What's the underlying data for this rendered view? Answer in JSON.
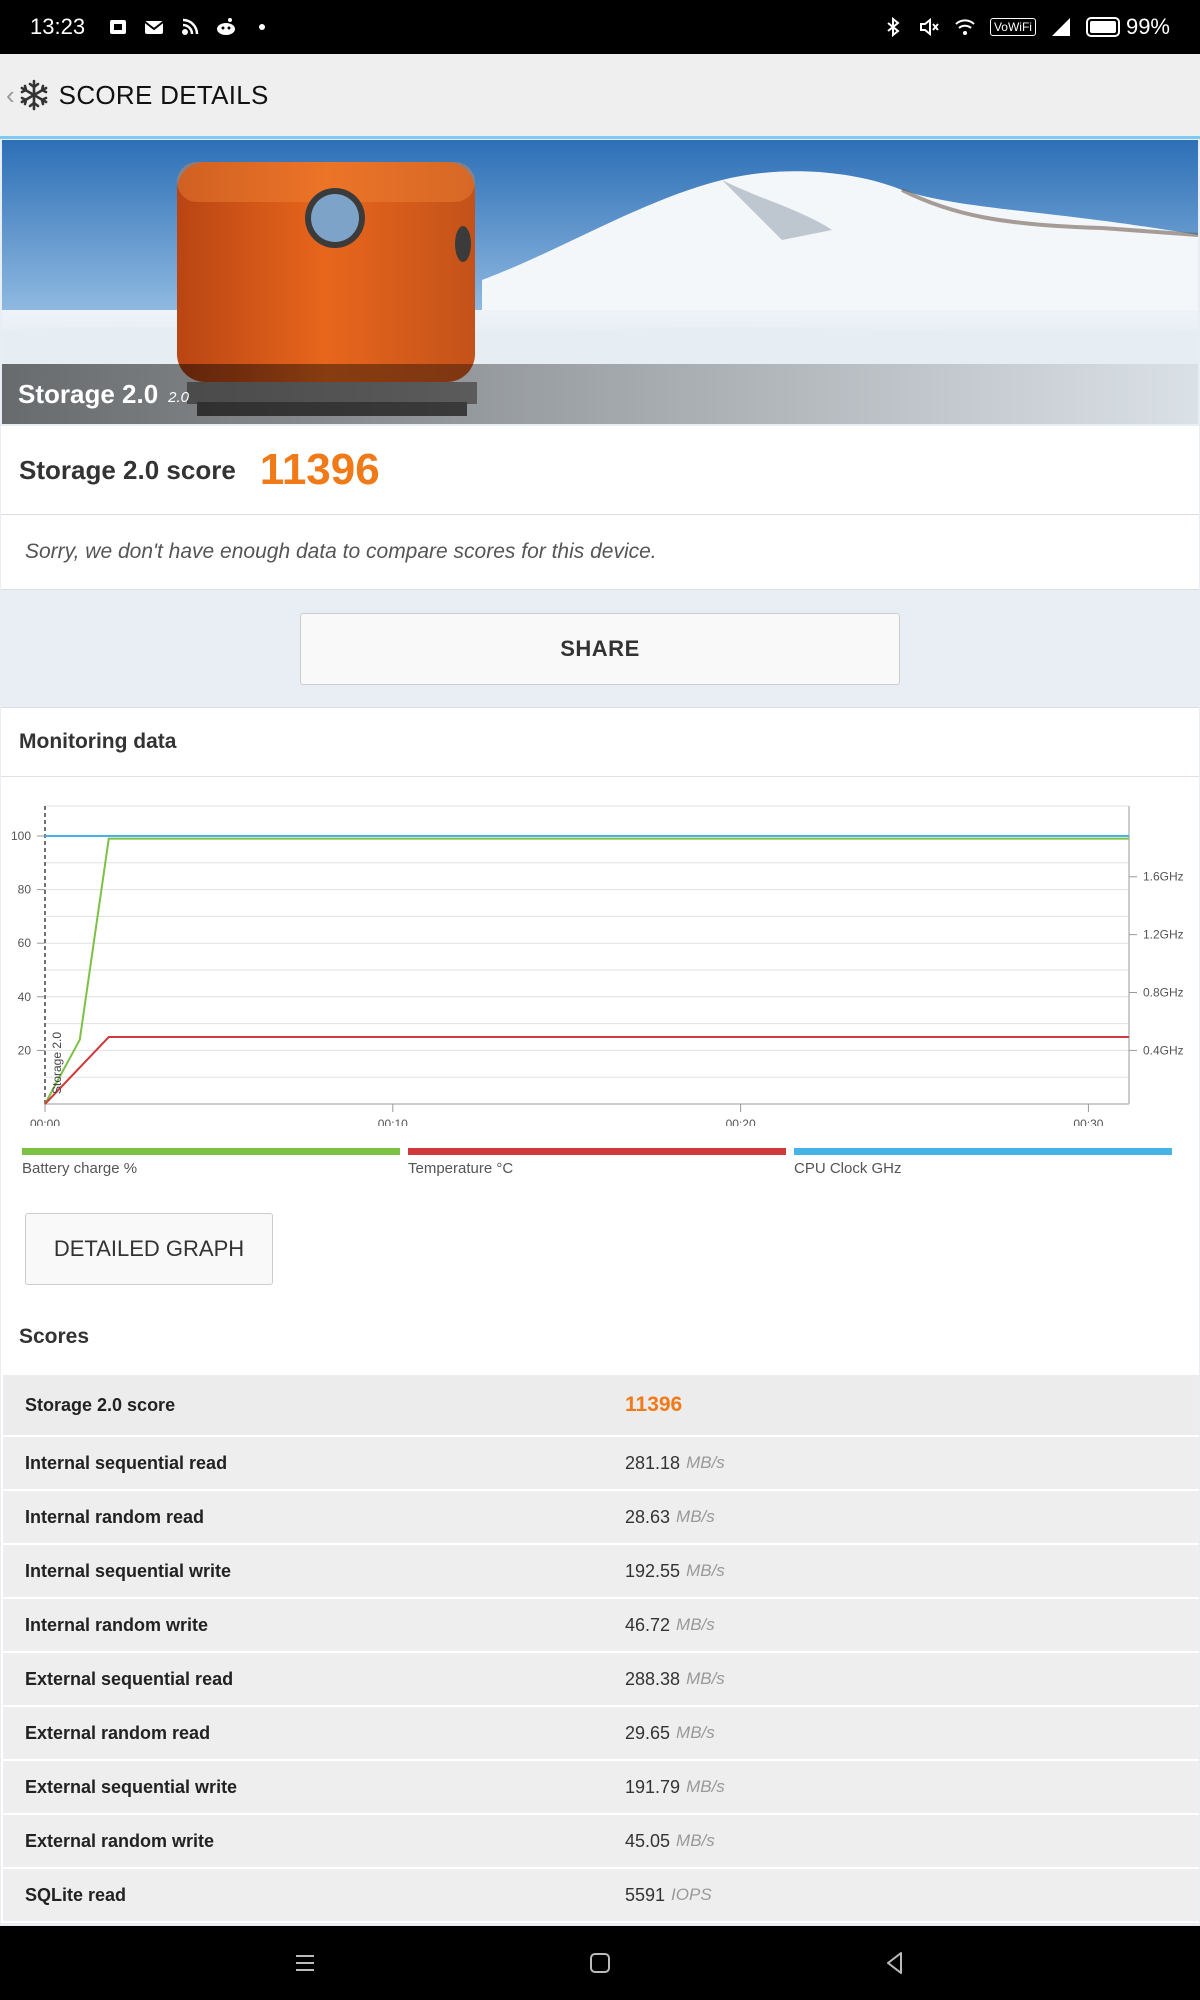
{
  "status_bar": {
    "time": "13:23",
    "battery_percent": "99%",
    "battery_level": 0.99,
    "vowifi": "VoWiFi",
    "icons": [
      "notification-icon",
      "mail-icon",
      "podcast-icon",
      "reddit-icon",
      "dot-icon",
      "bluetooth-icon",
      "mute-icon",
      "wifi-icon",
      "vowifi-badge",
      "signal-icon",
      "battery-icon"
    ]
  },
  "app_bar": {
    "title": "SCORE DETAILS",
    "back_icon": "chevron-left-icon",
    "app_icon": "snowflake-icon"
  },
  "hero": {
    "title": "Storage 2.0",
    "version": "2.0"
  },
  "score": {
    "label": "Storage 2.0 score",
    "value": "11396"
  },
  "notice": "Sorry, we don't have enough data to compare scores for this device.",
  "share_button": "SHARE",
  "monitoring": {
    "title": "Monitoring data",
    "detailed_button": "DETAILED GRAPH",
    "legend": [
      {
        "label": "Battery charge %",
        "color": "#7bc143"
      },
      {
        "label": "Temperature °C",
        "color": "#d13a3a"
      },
      {
        "label": "CPU Clock GHz",
        "color": "#46b3e6"
      }
    ]
  },
  "chart_data": {
    "type": "line",
    "x_ticks": [
      "00:00",
      "00:10",
      "00:20",
      "00:30"
    ],
    "y_ticks": [
      "20",
      "40",
      "60",
      "80",
      "100"
    ],
    "y2_ticks": [
      "0.4GHz",
      "0.8GHz",
      "1.2GHz",
      "1.6GHz"
    ],
    "ylim": [
      0,
      100
    ],
    "xlim_seconds": [
      0,
      1870
    ],
    "annotation": "Storage 2.0",
    "grid": true,
    "series": [
      {
        "name": "Battery charge %",
        "color": "#7bc143",
        "points": [
          [
            0,
            0
          ],
          [
            60,
            24
          ],
          [
            110,
            99
          ],
          [
            1870,
            99
          ]
        ]
      },
      {
        "name": "Temperature °C",
        "color": "#d13a3a",
        "points": [
          [
            0,
            0
          ],
          [
            110,
            25
          ],
          [
            1870,
            25
          ]
        ]
      },
      {
        "name": "CPU Clock GHz",
        "color": "#46b3e6",
        "points": [
          [
            0,
            100
          ],
          [
            1870,
            100
          ]
        ]
      }
    ]
  },
  "scores": {
    "title": "Scores",
    "rows": [
      {
        "label": "Storage 2.0 score",
        "value": "11396",
        "unit": ""
      },
      {
        "label": "Internal sequential read",
        "value": "281.18",
        "unit": "MB/s"
      },
      {
        "label": "Internal random read",
        "value": "28.63",
        "unit": "MB/s"
      },
      {
        "label": "Internal sequential write",
        "value": "192.55",
        "unit": "MB/s"
      },
      {
        "label": "Internal random write",
        "value": "46.72",
        "unit": "MB/s"
      },
      {
        "label": "External sequential read",
        "value": "288.38",
        "unit": "MB/s"
      },
      {
        "label": "External random read",
        "value": "29.65",
        "unit": "MB/s"
      },
      {
        "label": "External sequential write",
        "value": "191.79",
        "unit": "MB/s"
      },
      {
        "label": "External random write",
        "value": "45.05",
        "unit": "MB/s"
      },
      {
        "label": "SQLite read",
        "value": "5591",
        "unit": "IOPS"
      }
    ]
  },
  "nav_bar": {
    "icons": [
      "menu-icon",
      "home-icon",
      "back-icon"
    ]
  }
}
